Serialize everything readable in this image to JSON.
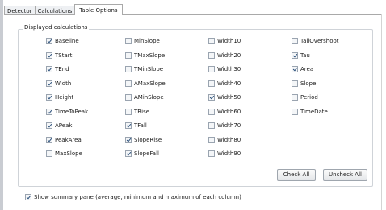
{
  "tabs": [
    {
      "label": "Detector",
      "active": false
    },
    {
      "label": "Calculations",
      "active": false
    },
    {
      "label": "Table Options",
      "active": true
    }
  ],
  "group_title": "Displayed calculations",
  "columns": [
    [
      {
        "label": "Baseline",
        "checked": true
      },
      {
        "label": "TStart",
        "checked": true
      },
      {
        "label": "TEnd",
        "checked": true
      },
      {
        "label": "Width",
        "checked": true
      },
      {
        "label": "Height",
        "checked": true
      },
      {
        "label": "TimeToPeak",
        "checked": true
      },
      {
        "label": "APeak",
        "checked": true
      },
      {
        "label": "PeakArea",
        "checked": true
      },
      {
        "label": "MaxSlope",
        "checked": false
      }
    ],
    [
      {
        "label": "MinSlope",
        "checked": false
      },
      {
        "label": "TMaxSlope",
        "checked": false
      },
      {
        "label": "TMinSlope",
        "checked": false
      },
      {
        "label": "AMaxSlope",
        "checked": false
      },
      {
        "label": "AMinSlope",
        "checked": false
      },
      {
        "label": "TRise",
        "checked": false
      },
      {
        "label": "TFall",
        "checked": true
      },
      {
        "label": "SlopeRise",
        "checked": true
      },
      {
        "label": "SlopeFall",
        "checked": true
      }
    ],
    [
      {
        "label": "Width10",
        "checked": false
      },
      {
        "label": "Width20",
        "checked": false
      },
      {
        "label": "Width30",
        "checked": false
      },
      {
        "label": "Width40",
        "checked": false
      },
      {
        "label": "Width50",
        "checked": true
      },
      {
        "label": "Width60",
        "checked": false
      },
      {
        "label": "Width70",
        "checked": false
      },
      {
        "label": "Width80",
        "checked": false
      },
      {
        "label": "Width90",
        "checked": false
      }
    ],
    [
      {
        "label": "TailOvershoot",
        "checked": false
      },
      {
        "label": "Tau",
        "checked": true
      },
      {
        "label": "Area",
        "checked": true
      },
      {
        "label": "Slope",
        "checked": false
      },
      {
        "label": "Period",
        "checked": false
      },
      {
        "label": "TimeDate",
        "checked": false
      }
    ]
  ],
  "buttons": {
    "check_all": "Check All",
    "uncheck_all": "Uncheck All"
  },
  "summary": {
    "label": "Show summary pane (average, minimum and maximum of each column)",
    "checked": true
  }
}
